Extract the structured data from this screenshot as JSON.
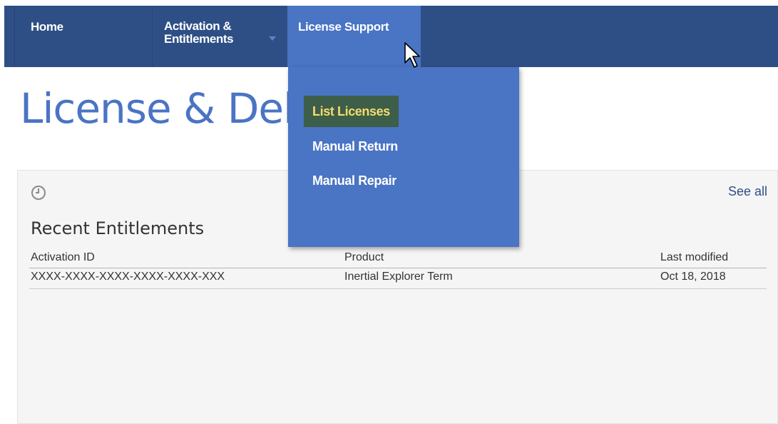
{
  "nav": {
    "items": [
      {
        "label": "Home"
      },
      {
        "label": "Activation & Entitlements"
      },
      {
        "label": "License Support"
      }
    ]
  },
  "page": {
    "title": "License & Del"
  },
  "dropdown": {
    "items": [
      {
        "label": "List Licenses",
        "highlighted": true
      },
      {
        "label": "Manual Return",
        "highlighted": false
      },
      {
        "label": "Manual Repair",
        "highlighted": false
      }
    ]
  },
  "panel": {
    "icon": "clock-icon",
    "see_all": "See all",
    "title": "Recent Entitlements",
    "columns": [
      "Activation ID",
      "Product",
      "Last modified"
    ],
    "rows": [
      [
        "XXXX-XXXX-XXXX-XXXX-XXXX-XXX",
        "Inertial Explorer Term",
        "Oct 18, 2018"
      ]
    ]
  },
  "colors": {
    "navbar": "#2e4f86",
    "nav_active": "#4a74c4",
    "menu_highlight_bg": "#3d5e49",
    "menu_highlight_text": "#f5dc6e",
    "title": "#4a74c4"
  }
}
